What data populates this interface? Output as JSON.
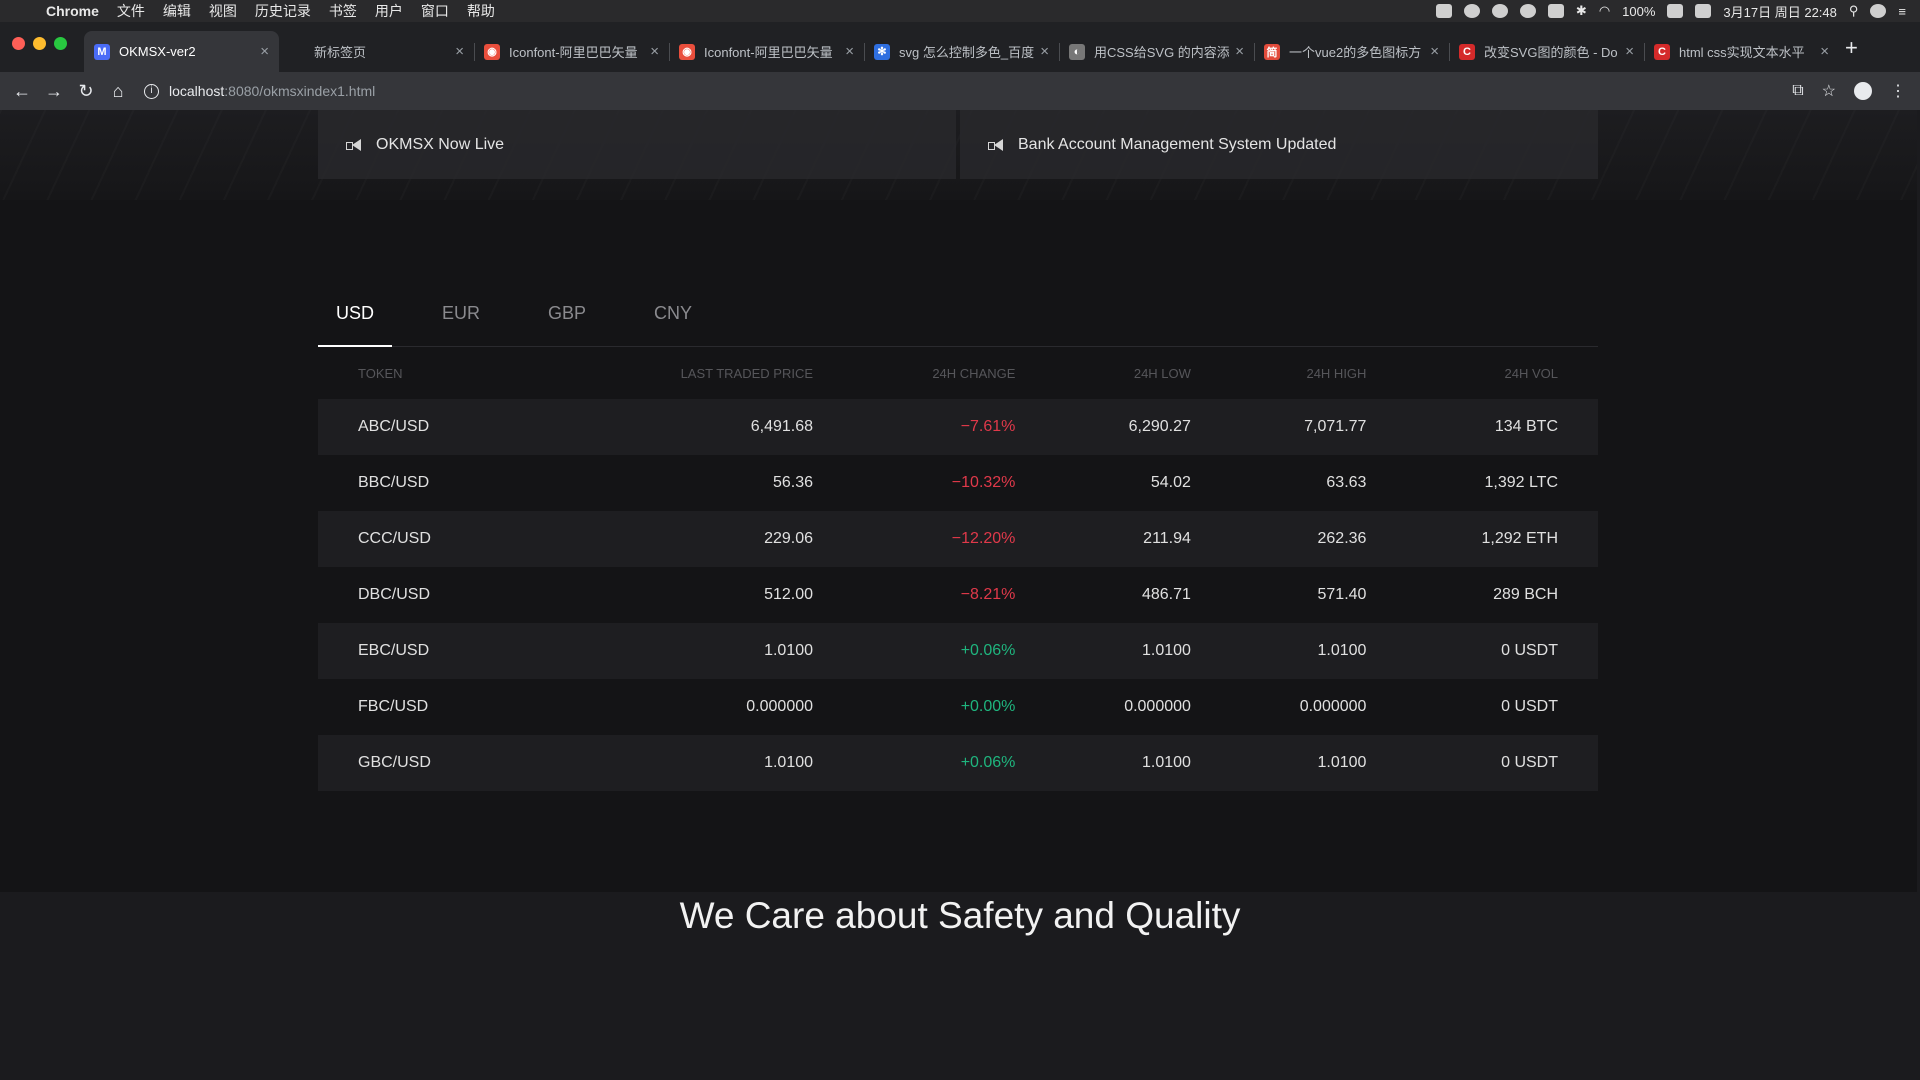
{
  "menubar": {
    "app": "Chrome",
    "items": [
      "文件",
      "编辑",
      "视图",
      "历史记录",
      "书签",
      "用户",
      "窗口",
      "帮助"
    ],
    "battery": "100%",
    "datetime": "3月17日 周日 22:48"
  },
  "browser": {
    "tabs": [
      {
        "title": "OKMSX-ver2",
        "favicon": "M",
        "color": "#4a6cf7",
        "active": true
      },
      {
        "title": "新标签页",
        "favicon": "",
        "color": "transparent",
        "active": false
      },
      {
        "title": "Iconfont-阿里巴巴矢量",
        "favicon": "◉",
        "color": "#e94e3c",
        "active": false
      },
      {
        "title": "Iconfont-阿里巴巴矢量",
        "favicon": "◉",
        "color": "#e94e3c",
        "active": false
      },
      {
        "title": "svg 怎么控制多色_百度",
        "favicon": "✻",
        "color": "#2f6fe0",
        "active": false
      },
      {
        "title": "用CSS给SVG 的内容添",
        "favicon": "◐",
        "color": "#777777",
        "active": false
      },
      {
        "title": "一个vue2的多色图标方",
        "favicon": "简",
        "color": "#e24b3b",
        "active": false
      },
      {
        "title": "改变SVG图的颜色 - Do",
        "favicon": "C",
        "color": "#d42a2a",
        "active": false
      },
      {
        "title": "html css实现文本水平",
        "favicon": "C",
        "color": "#d42a2a",
        "active": false
      }
    ],
    "url_host": "localhost",
    "url_path": ":8080/okmsxindex1.html"
  },
  "notices": [
    {
      "text": "OKMSX Now Live"
    },
    {
      "text": "Bank Account Management System Updated"
    }
  ],
  "market": {
    "currencies": [
      "USD",
      "EUR",
      "GBP",
      "CNY"
    ],
    "active_currency": "USD",
    "columns": [
      "TOKEN",
      "LAST TRADED PRICE",
      "24H CHANGE",
      "24H LOW",
      "24H HIGH",
      "24H VOL"
    ],
    "rows": [
      {
        "token": "ABC/USD",
        "price": "6,491.68",
        "change": "−7.61%",
        "direction": "down",
        "low": "6,290.27",
        "high": "7,071.77",
        "vol": "134 BTC"
      },
      {
        "token": "BBC/USD",
        "price": "56.36",
        "change": "−10.32%",
        "direction": "down",
        "low": "54.02",
        "high": "63.63",
        "vol": "1,392 LTC"
      },
      {
        "token": "CCC/USD",
        "price": "229.06",
        "change": "−12.20%",
        "direction": "down",
        "low": "211.94",
        "high": "262.36",
        "vol": "1,292 ETH"
      },
      {
        "token": "DBC/USD",
        "price": "512.00",
        "change": "−8.21%",
        "direction": "down",
        "low": "486.71",
        "high": "571.40",
        "vol": "289 BCH"
      },
      {
        "token": "EBC/USD",
        "price": "1.0100",
        "change": "+0.06%",
        "direction": "up",
        "low": "1.0100",
        "high": "1.0100",
        "vol": "0 USDT"
      },
      {
        "token": "FBC/USD",
        "price": "0.000000",
        "change": "+0.00%",
        "direction": "up",
        "low": "0.000000",
        "high": "0.000000",
        "vol": "0 USDT"
      },
      {
        "token": "GBC/USD",
        "price": "1.0100",
        "change": "+0.06%",
        "direction": "up",
        "low": "1.0100",
        "high": "1.0100",
        "vol": "0 USDT"
      }
    ]
  },
  "section": {
    "title": "We Care about Safety and Quality"
  },
  "colors": {
    "negative": "#e0394a",
    "positive": "#1fb57e",
    "background": "#141416"
  }
}
